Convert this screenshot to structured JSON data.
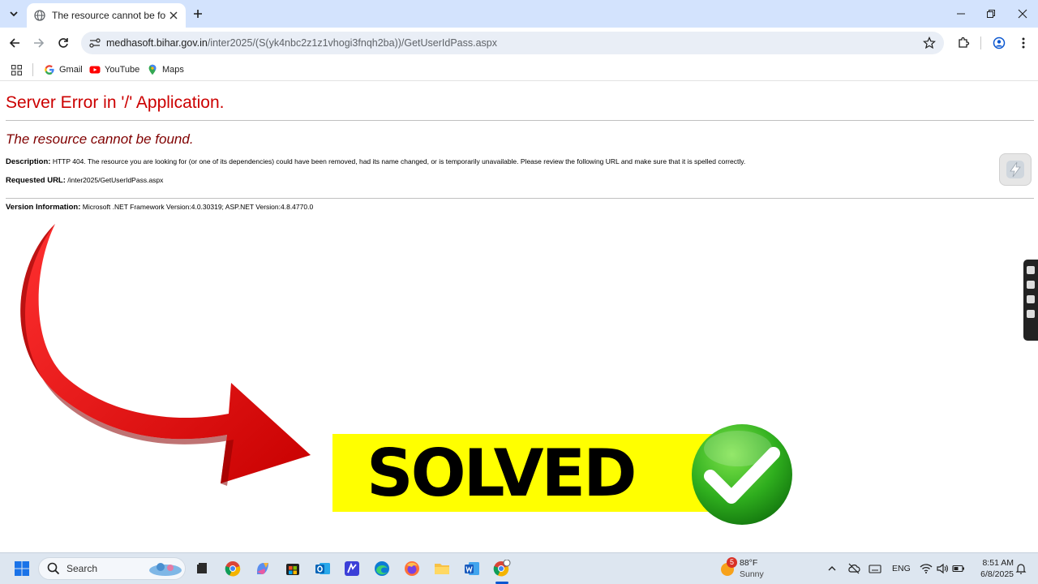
{
  "browser": {
    "tab_title": "The resource cannot be found.",
    "url_host": "medhasoft.bihar.gov.in",
    "url_path": "/inter2025/(S(yk4nbc2z1z1vhogi3fnqh2ba))/GetUserIdPass.aspx",
    "bookmarks": [
      {
        "label": "Gmail",
        "icon": "google-icon"
      },
      {
        "label": "YouTube",
        "icon": "youtube-icon"
      },
      {
        "label": "Maps",
        "icon": "maps-icon"
      }
    ]
  },
  "page": {
    "heading": "Server Error in '/' Application.",
    "subheading": "The resource cannot be found.",
    "description_label": "Description:",
    "description_text": "HTTP 404. The resource you are looking for (or one of its dependencies) could have been removed, had its name changed, or is temporarily unavailable.  Please review the following URL and make sure that it is spelled correctly.",
    "requested_url_label": "Requested URL:",
    "requested_url_value": "/inter2025/GetUserIdPass.aspx",
    "version_label": "Version Information:",
    "version_value": "Microsoft .NET Framework Version:4.0.30319; ASP.NET Version:4.8.4770.0"
  },
  "overlay": {
    "banner_text": "SOLVED",
    "banner_color": "#ffff00",
    "arrow_color": "#e00000",
    "check_color": "#2fae1e"
  },
  "taskbar": {
    "search_placeholder": "Search",
    "weather_badge": "5",
    "weather_temp": "88°F",
    "weather_condition": "Sunny",
    "language": "ENG",
    "time": "8:51 AM",
    "date": "6/8/2025"
  }
}
